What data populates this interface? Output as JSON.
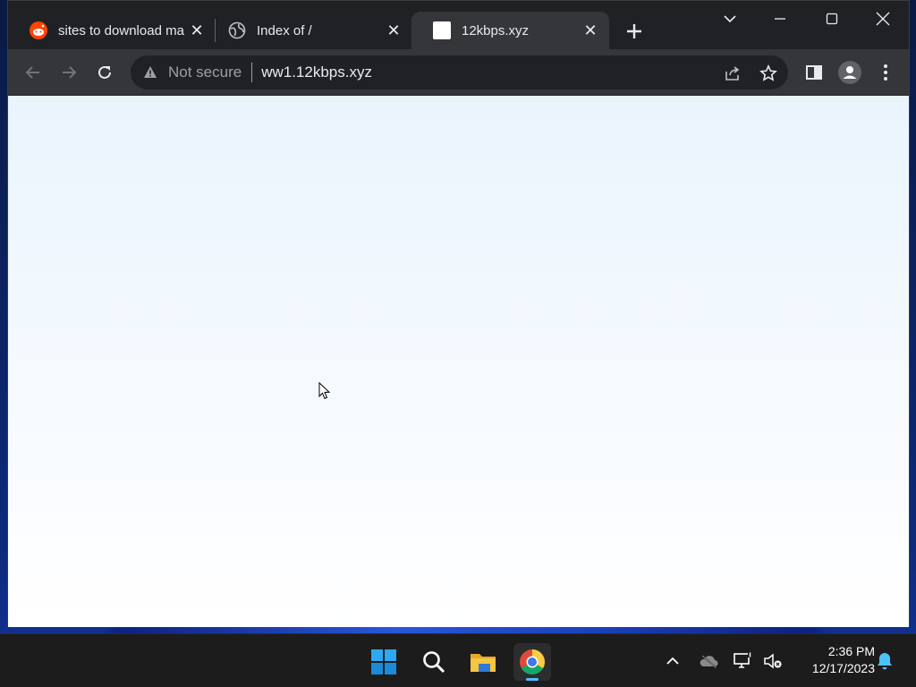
{
  "browser": {
    "tabs": [
      {
        "title": "sites to download ma",
        "favicon": "reddit-icon",
        "active": false
      },
      {
        "title": "Index of /",
        "favicon": "globe-icon",
        "active": false
      },
      {
        "title": "12kbps.xyz",
        "favicon": "blank-page-icon",
        "active": true
      }
    ],
    "new_tab_icon": "plus-icon",
    "window_controls": [
      "tab-search-icon",
      "minimize-icon",
      "maximize-icon",
      "close-icon"
    ],
    "omnibox": {
      "security_label": "Not secure",
      "url": "ww1.12kbps.xyz"
    },
    "colors": {
      "frame": "#202124",
      "toolbar": "#35363a",
      "text": "#e8eaed",
      "muted": "#9aa0a6"
    }
  },
  "taskbar": {
    "apps": [
      "windows-start-icon",
      "search-icon",
      "file-explorer-icon",
      "chrome-icon"
    ],
    "active_app": "chrome-icon",
    "tray": [
      "chevron-up-icon",
      "onedrive-offline-icon",
      "network-icon",
      "volume-muted-icon",
      "notification-bell-icon"
    ],
    "clock": {
      "time": "2:36 PM",
      "date": "12/17/2023"
    },
    "accent": "#4cc2ff"
  }
}
